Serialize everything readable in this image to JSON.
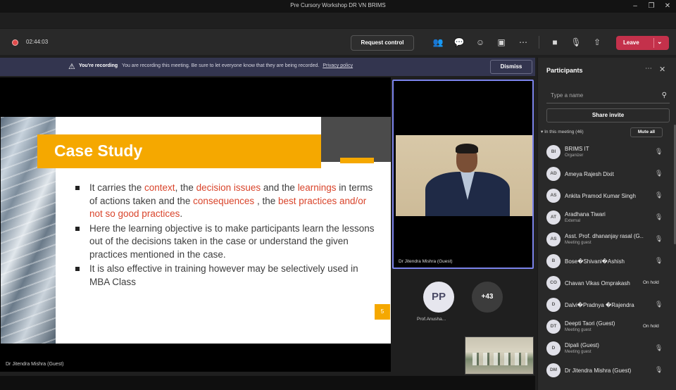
{
  "window": {
    "title": "Pre Cursory Workshop DR VN BRIMS"
  },
  "toolbar": {
    "timer": "02:44:03",
    "request_control_label": "Request control",
    "leave_label": "Leave"
  },
  "banner": {
    "heading": "You're recording",
    "message": "You are recording this meeting. Be sure to let everyone know that they are being recorded.",
    "link": "Privacy policy",
    "dismiss_label": "Dismiss"
  },
  "slide": {
    "title": "Case Study",
    "bullet1": {
      "t1": "It carries the ",
      "h1": "context",
      "t2": ", the ",
      "h2": "decision issues",
      "t3": " and the ",
      "h3": "learnings",
      "t4": " in terms of actions taken and the ",
      "h4": "consequences",
      "t5": " , the ",
      "h5": "best practices and/or not so good practices",
      "t6": "."
    },
    "bullet2": "Here the learning objective is to make participants learn the lessons out of the decisions taken in the case or understand the given practices mentioned in the case.",
    "bullet3": "It is also effective in training however may be selectively used in MBA Class",
    "page_number": "5"
  },
  "stage": {
    "presenter_label": "Dr Jitendra Mishra (Guest)"
  },
  "video": {
    "name": "Dr Jitendra Mishra (Guest)",
    "avatar_initials": "PP",
    "avatar_name": "Prof.Anusha...",
    "more_count": "+43"
  },
  "participants": {
    "title": "Participants",
    "search_placeholder": "Type a name",
    "share_invite_label": "Share invite",
    "section_label": "In this meeting (46)",
    "mute_all_label": "Mute all",
    "items": [
      {
        "initials": "BI",
        "name": "BRIMS IT",
        "sub": "Organizer",
        "status": ""
      },
      {
        "initials": "AD",
        "name": "Ameya Rajesh Dixit",
        "sub": "",
        "status": ""
      },
      {
        "initials": "AS",
        "name": "Ankita Pramod Kumar Singh",
        "sub": "",
        "status": ""
      },
      {
        "initials": "AT",
        "name": "Aradhana Tiwari",
        "sub": "External",
        "status": ""
      },
      {
        "initials": "AS",
        "name": "Asst. Prof. dhananjay rasal (G...",
        "sub": "Meeting guest",
        "status": ""
      },
      {
        "initials": "B",
        "name": "Bose�Shivani�Ashish",
        "sub": "",
        "status": ""
      },
      {
        "initials": "CO",
        "name": "Chavan Vikas Omprakash",
        "sub": "",
        "status": "On hold"
      },
      {
        "initials": "D",
        "name": "Dalvi�Pradnya �Rajendra",
        "sub": "",
        "status": ""
      },
      {
        "initials": "DT",
        "name": "Deepti Taori (Guest)",
        "sub": "Meeting guest",
        "status": "On hold"
      },
      {
        "initials": "D",
        "name": "Dipali (Guest)",
        "sub": "Meeting guest",
        "status": ""
      },
      {
        "initials": "DM",
        "name": "Dr Jitendra Mishra (Guest)",
        "sub": "",
        "status": ""
      }
    ]
  }
}
